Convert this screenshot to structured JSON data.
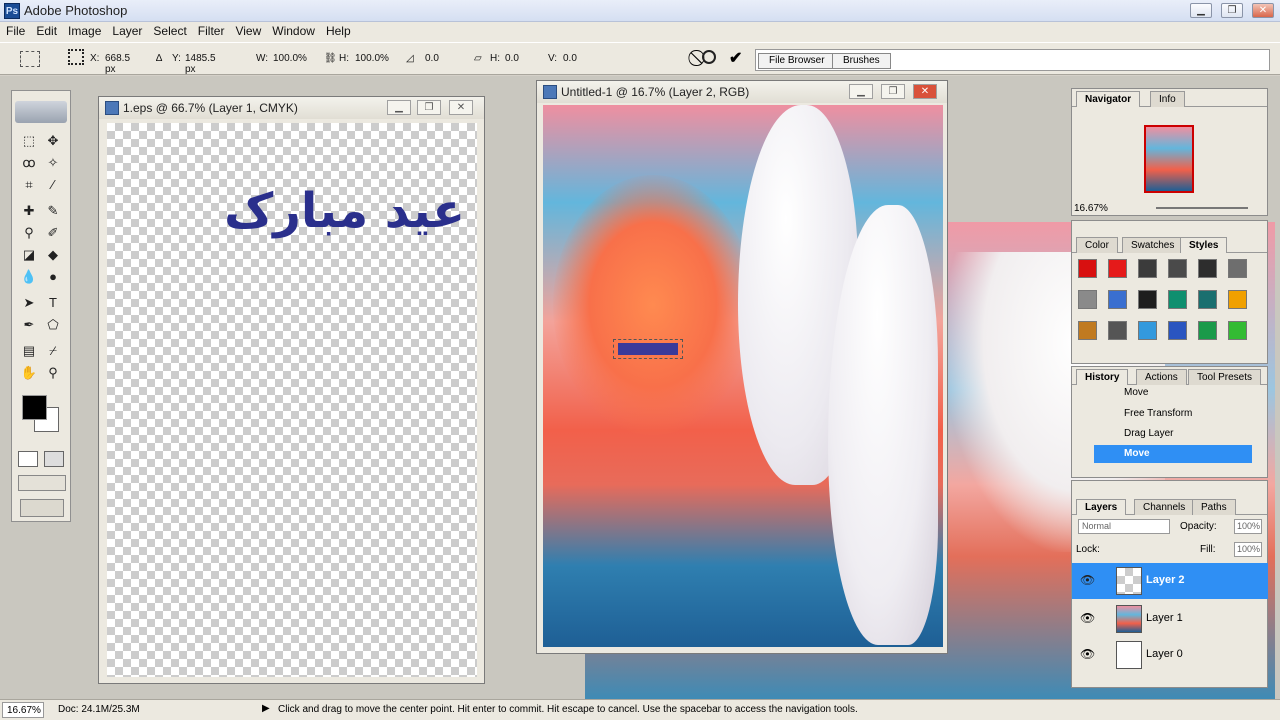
{
  "app": {
    "title": "Adobe Photoshop"
  },
  "menu": [
    "File",
    "Edit",
    "Image",
    "Layer",
    "Select",
    "Filter",
    "View",
    "Window",
    "Help"
  ],
  "options": {
    "x_label": "X:",
    "x_value": "668.5 px",
    "y_label": "Y:",
    "y_value": "1485.5 px",
    "w_label": "W:",
    "w_value": "100.0%",
    "h_label": "H:",
    "h_value": "100.0%",
    "angle_value": "0.0",
    "skew_h_label": "H:",
    "skew_h_value": "0.0",
    "skew_v_label": "V:",
    "skew_v_value": "0.0",
    "cancel_icon": "cancel-icon",
    "commit_icon": "check-icon"
  },
  "palette_well": {
    "tabs": [
      "File Browser",
      "Brushes"
    ]
  },
  "doc1": {
    "title": "1.eps @ 66.7% (Layer 1, CMYK)",
    "text": "عید مبارک",
    "text_color": "#2a2f8c"
  },
  "doc2": {
    "title": "Untitled-1 @ 16.7% (Layer 2, RGB)"
  },
  "navigator": {
    "tabs": [
      "Navigator",
      "Info"
    ],
    "zoom": "16.67%"
  },
  "styles_panel": {
    "tabs": [
      "Color",
      "Swatches",
      "Styles"
    ],
    "swatch_colors": [
      "#d81010",
      "#e51a1a",
      "#3b3b3b",
      "#4a4a4a",
      "#2d2d2d",
      "#6e6e6e",
      "#8a8a8a",
      "#3a6fd0",
      "#1e1e1e",
      "#0f8f6f",
      "#1a6f6f",
      "#f0a000",
      "#c07a20",
      "#555555",
      "#3399dd",
      "#2a55c0",
      "#1a9a4a",
      "#33bb33"
    ]
  },
  "history": {
    "tabs": [
      "History",
      "Actions",
      "Tool Presets"
    ],
    "items": [
      "Move",
      "Free Transform",
      "Drag Layer",
      "Move"
    ]
  },
  "layers": {
    "tabs": [
      "Layers",
      "Channels",
      "Paths"
    ],
    "blend_mode": "Normal",
    "opacity_label": "Opacity:",
    "opacity_value": "100%",
    "lock_label": "Lock:",
    "fill_label": "Fill:",
    "fill_value": "100%",
    "items": [
      "Layer 2",
      "Layer 1",
      "Layer 0"
    ]
  },
  "status": {
    "zoom": "16.67%",
    "doc_size": "Doc: 24.1M/25.3M",
    "message": "Click and drag to move the center point. Hit enter to commit. Hit escape to cancel. Use the spacebar to access the navigation tools."
  }
}
